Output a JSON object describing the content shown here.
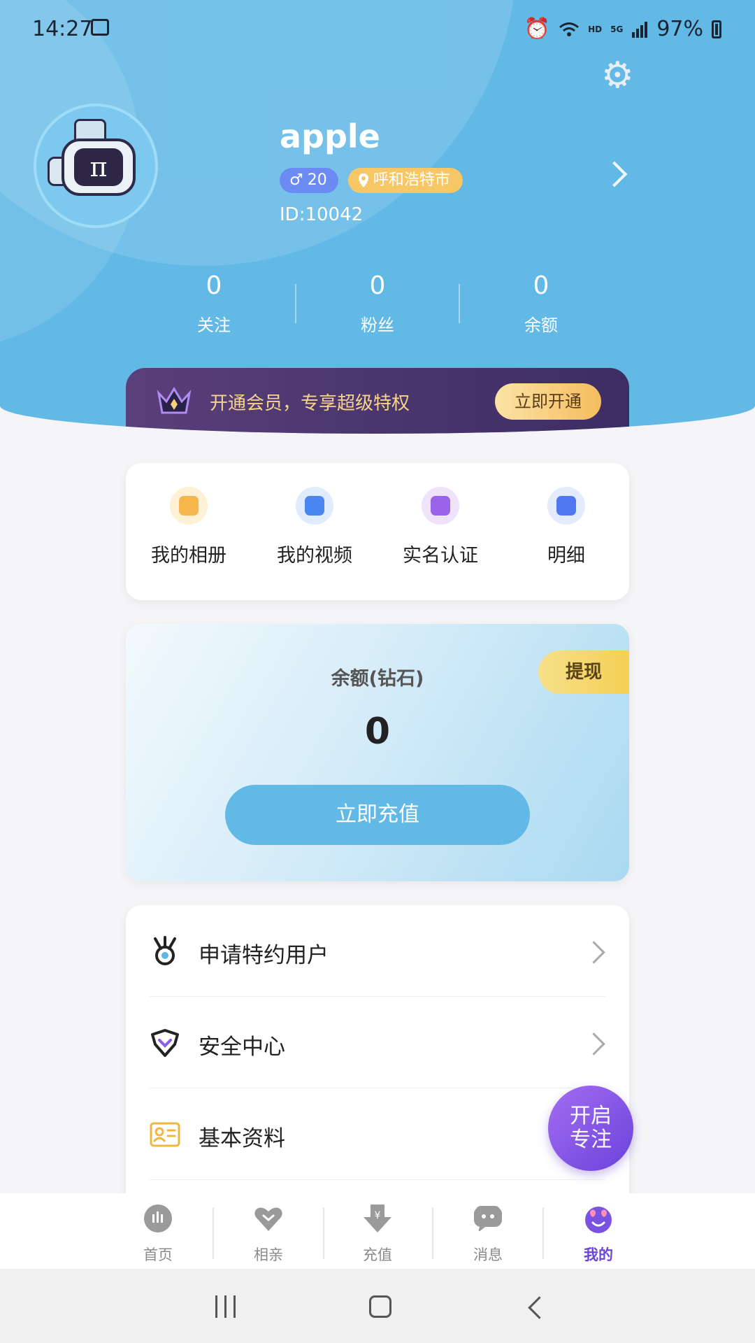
{
  "status_bar": {
    "time": "14:27",
    "hd": "HD",
    "net": "5G",
    "battery": "97%"
  },
  "profile": {
    "name": "apple",
    "gender_symbol": "♂",
    "age": "20",
    "city": "呼和浩特市",
    "id": "ID:10042",
    "avatar_glyph": "π"
  },
  "stats": [
    {
      "value": "0",
      "label": "关注"
    },
    {
      "value": "0",
      "label": "粉丝"
    },
    {
      "value": "0",
      "label": "余额"
    }
  ],
  "vip": {
    "text": "开通会员，专享超级特权",
    "button": "立即开通"
  },
  "quick_actions": [
    {
      "label": "我的相册",
      "icon": "photo-album-icon",
      "color": "#f7b64c",
      "glow": "#fff1d6"
    },
    {
      "label": "我的视频",
      "icon": "video-play-icon",
      "color": "#4a86f0",
      "glow": "#e0ecfd"
    },
    {
      "label": "实名认证",
      "icon": "verified-badge-icon",
      "color": "#9a63e8",
      "glow": "#efe3fc"
    },
    {
      "label": "明细",
      "icon": "clipboard-detail-icon",
      "color": "#4f78ee",
      "glow": "#e3ebfd"
    }
  ],
  "balance": {
    "title": "余额(钻石)",
    "value": "0",
    "recharge_button": "立即充值",
    "withdraw_button": "提现"
  },
  "menu": [
    {
      "label": "申请特约用户",
      "icon": "medal-icon"
    },
    {
      "label": "安全中心",
      "icon": "shield-check-icon"
    },
    {
      "label": "基本资料",
      "icon": "id-card-icon"
    }
  ],
  "focus_fab": {
    "line1": "开启",
    "line2": "专注"
  },
  "tabs": [
    {
      "label": "首页",
      "icon": "home-bubble-icon",
      "active": false
    },
    {
      "label": "相亲",
      "icon": "heart-icon",
      "active": false
    },
    {
      "label": "充值",
      "icon": "recharge-yen-icon",
      "active": false
    },
    {
      "label": "消息",
      "icon": "message-bubble-icon",
      "active": false
    },
    {
      "label": "我的",
      "icon": "profile-smiley-icon",
      "active": true
    }
  ],
  "colors": {
    "header_blue": "#62b9e6",
    "accent_purple": "#6b44d8",
    "vip_gold": "#f6d58a"
  }
}
